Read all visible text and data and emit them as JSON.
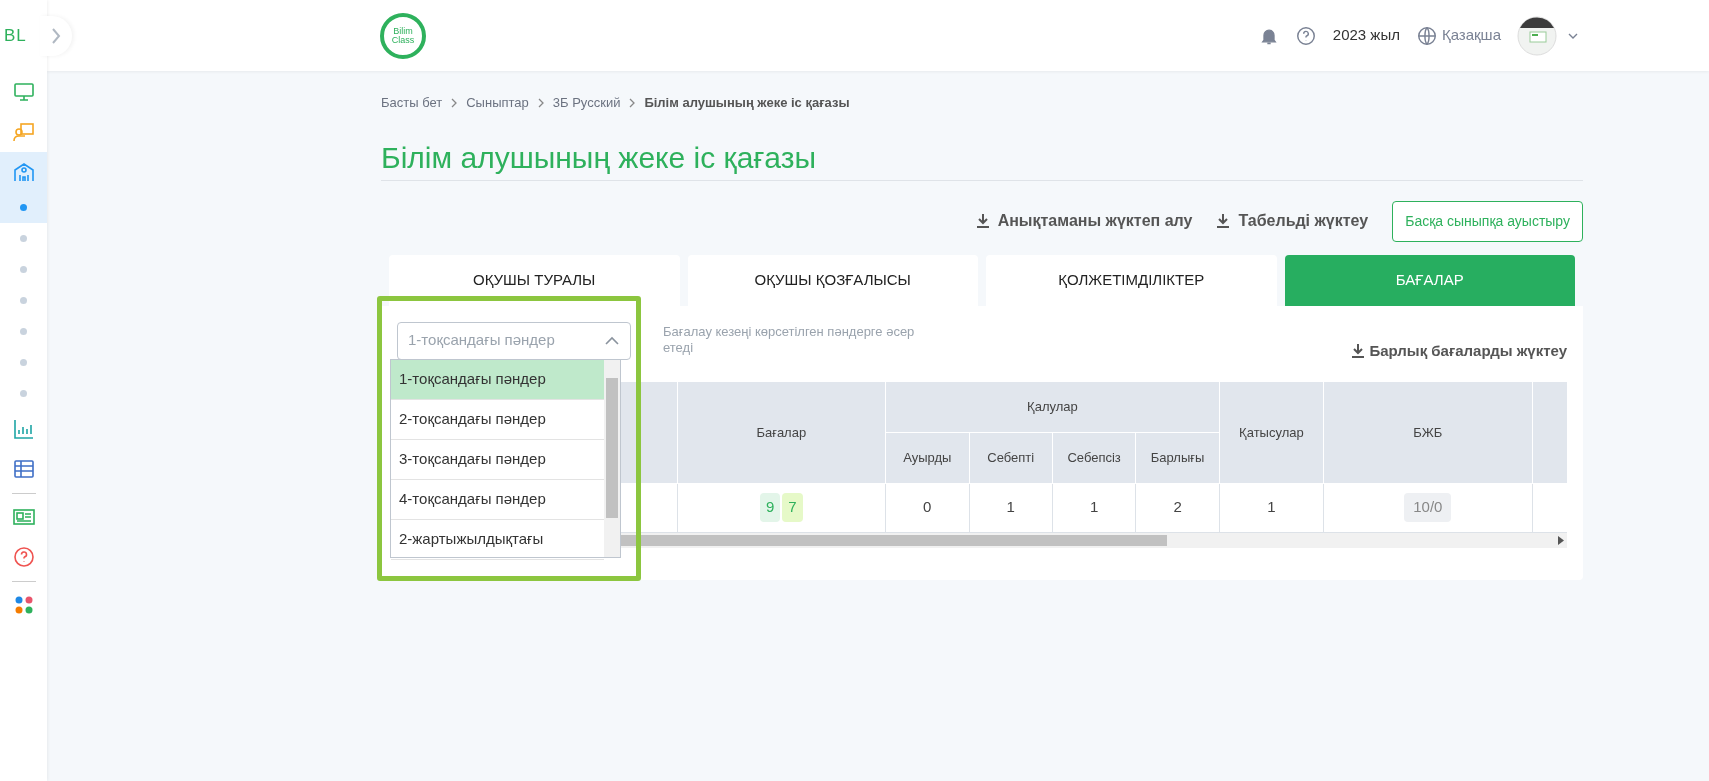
{
  "sidebar": {
    "logo": "BL",
    "items": [
      {
        "kind": "monitor",
        "selected": false
      },
      {
        "kind": "teacher",
        "selected": false
      },
      {
        "kind": "school",
        "selected": true
      },
      {
        "kind": "dot",
        "selected": true
      },
      {
        "kind": "dot",
        "selected": false
      },
      {
        "kind": "dot",
        "selected": false
      },
      {
        "kind": "dot",
        "selected": false
      },
      {
        "kind": "dot",
        "selected": false
      },
      {
        "kind": "dot",
        "selected": false
      },
      {
        "kind": "dot",
        "selected": false
      },
      {
        "kind": "chart",
        "selected": false
      },
      {
        "kind": "table",
        "selected": false
      },
      {
        "kind": "divider"
      },
      {
        "kind": "news",
        "selected": false
      },
      {
        "kind": "help",
        "selected": false
      },
      {
        "kind": "divider"
      },
      {
        "kind": "apps",
        "selected": false
      }
    ]
  },
  "header": {
    "logo_lines": [
      "Bilim",
      "Class"
    ],
    "year": "2023 жыл",
    "language": "Қазақша"
  },
  "breadcrumb": [
    {
      "label": "Басты бет",
      "current": false
    },
    {
      "label": "Сыныптар",
      "current": false
    },
    {
      "label": "3Б Русский",
      "current": false
    },
    {
      "label": "Білім алушының жеке іс қағазы",
      "current": true
    }
  ],
  "title": "Білім алушының жеке іс қағазы",
  "actions": [
    {
      "label": "Анықтаманы жүктеп алу",
      "kind": "download"
    },
    {
      "label": "Табельді жүктеу",
      "kind": "download"
    },
    {
      "label": "Басқа сыныпқа ауыстыру",
      "kind": "outline"
    }
  ],
  "tabs": [
    {
      "label": "ОҚУШЫ ТУРАЛЫ",
      "selected": false
    },
    {
      "label": "ОҚУШЫ ҚОЗҒАЛЫСЫ",
      "selected": false
    },
    {
      "label": "ҚОЛЖЕТІМДІЛІКТЕР",
      "selected": false
    },
    {
      "label": "БАҒАЛАР",
      "selected": true
    }
  ],
  "period_select": {
    "placeholder": "1-тоқсандағы пәндер",
    "expanded": true,
    "options": [
      {
        "label": "1-тоқсандағы пәндер",
        "selected": true
      },
      {
        "label": "2-тоқсандағы пәндер",
        "selected": false
      },
      {
        "label": "3-тоқсандағы пәндер",
        "selected": false
      },
      {
        "label": "4-тоқсандағы пәндер",
        "selected": false
      },
      {
        "label": "2-жартыжылдықтағы",
        "selected": false
      }
    ]
  },
  "hint": "Бағалау кезеңі көрсетілген пәндерге әсер етеді",
  "download_all": "Барлық бағаларды жүктеу",
  "table": {
    "grades_header": "Бағалар",
    "absences_header": "Қалулар",
    "absence_columns": [
      "Ауырды",
      "Себепті",
      "Себепсіз",
      "Барлығы"
    ],
    "attendance_header": "Қатысулар",
    "bzhb_header": "БЖБ",
    "rows": [
      {
        "grades": [
          {
            "value": "9",
            "color": "#e3f5e9"
          },
          {
            "value": "7",
            "color": "#e6f9c8"
          }
        ],
        "absences": [
          "0",
          "1",
          "1",
          "2"
        ],
        "attendance": "1",
        "bzhb": "10/0"
      }
    ]
  }
}
